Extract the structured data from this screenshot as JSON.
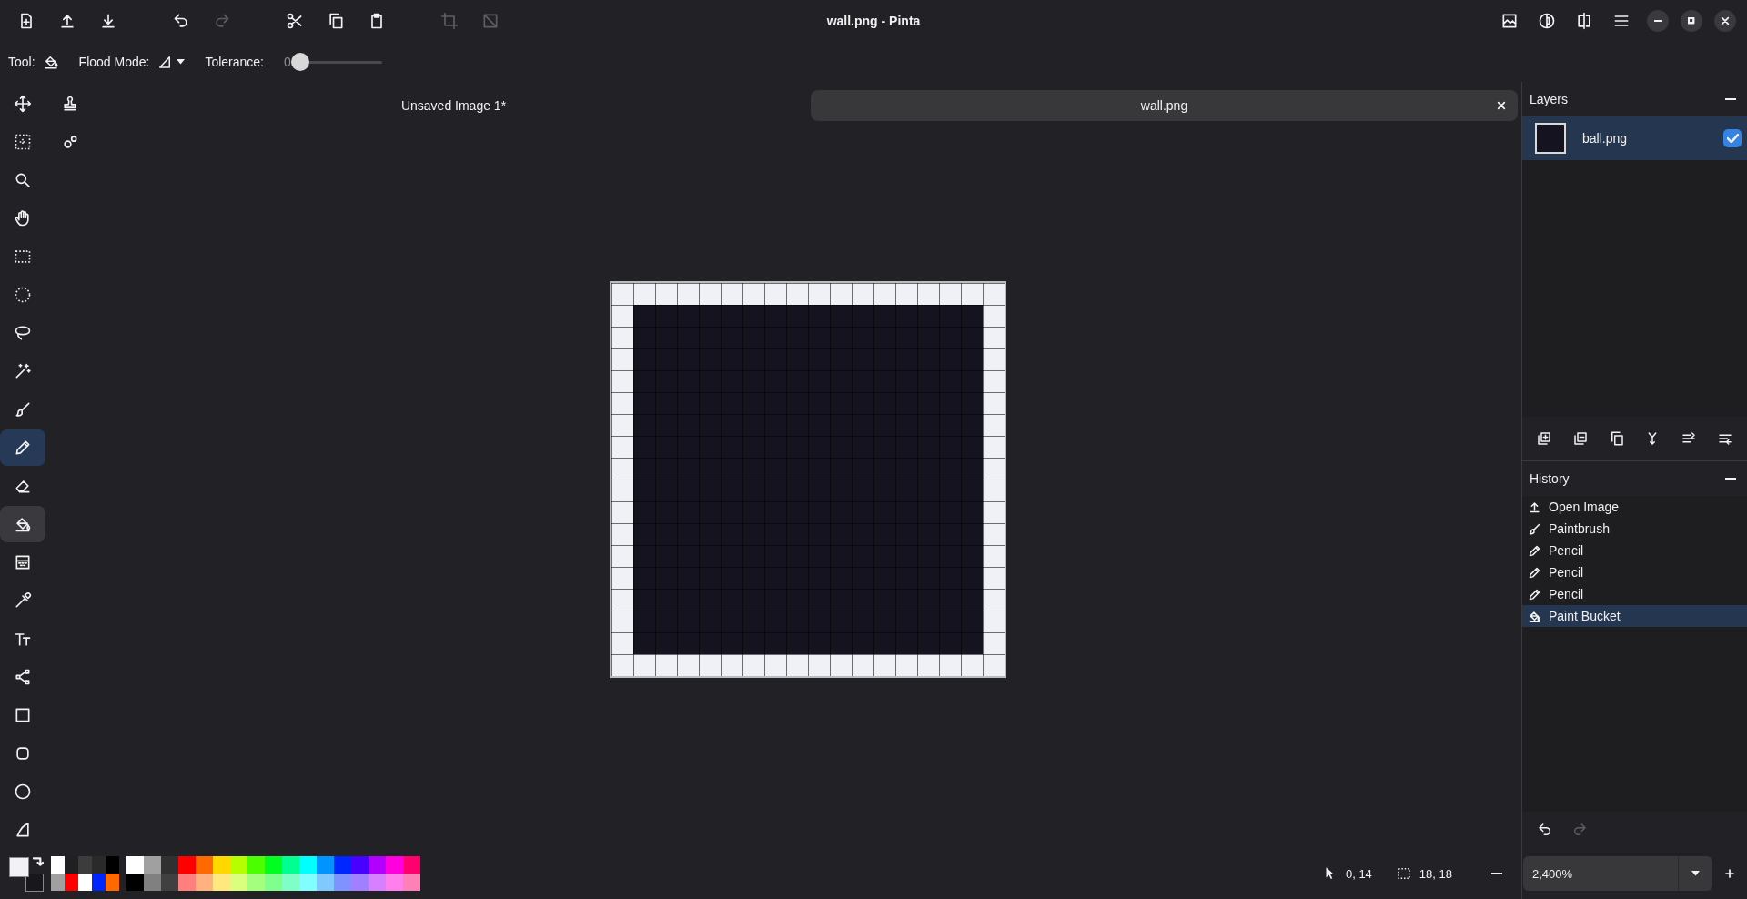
{
  "header": {
    "title": "wall.png - Pinta",
    "left_buttons": [
      {
        "kind": "new",
        "disabled": false
      },
      {
        "kind": "open",
        "disabled": false
      },
      {
        "kind": "save",
        "disabled": false
      },
      {
        "kind": "undo",
        "disabled": false
      },
      {
        "kind": "redo",
        "disabled": true
      },
      {
        "kind": "cut",
        "disabled": false
      },
      {
        "kind": "copy",
        "disabled": false
      },
      {
        "kind": "paste",
        "disabled": false
      },
      {
        "kind": "crop",
        "disabled": true
      },
      {
        "kind": "deselect",
        "disabled": true
      }
    ],
    "right_buttons": [
      {
        "kind": "image"
      },
      {
        "kind": "adjustments"
      },
      {
        "kind": "effects"
      },
      {
        "kind": "menu"
      }
    ],
    "window_controls": [
      {
        "kind": "minimize"
      },
      {
        "kind": "maximize"
      },
      {
        "kind": "close"
      }
    ]
  },
  "toolbar": {
    "tool_label": "Tool:",
    "tool": {
      "kind": "bucket"
    },
    "flood_mode_label": "Flood Mode:",
    "tolerance_label": "Tolerance:",
    "tolerance_value": "0",
    "tolerance": {
      "level": 0
    }
  },
  "tools": [
    {
      "kind": "move",
      "selected": false,
      "hovered": false
    },
    {
      "kind": "moveselection",
      "selected": false,
      "hovered": false
    },
    {
      "kind": "zoom",
      "selected": false,
      "hovered": false
    },
    {
      "kind": "pan",
      "selected": false,
      "hovered": false
    },
    {
      "kind": "rectselect",
      "selected": false,
      "hovered": false
    },
    {
      "kind": "ellipseselect",
      "selected": false,
      "hovered": false
    },
    {
      "kind": "lasso",
      "selected": false,
      "hovered": false
    },
    {
      "kind": "wand",
      "selected": false,
      "hovered": false
    },
    {
      "kind": "paintbrush",
      "selected": false,
      "hovered": false
    },
    {
      "kind": "pencil",
      "selected": false,
      "hovered": true
    },
    {
      "kind": "eraser",
      "selected": false,
      "hovered": false
    },
    {
      "kind": "bucket",
      "selected": true,
      "hovered": false
    },
    {
      "kind": "gradient",
      "selected": false,
      "hovered": false
    },
    {
      "kind": "picker",
      "selected": false,
      "hovered": false
    },
    {
      "kind": "text",
      "selected": false,
      "hovered": false
    },
    {
      "kind": "curve",
      "selected": false,
      "hovered": false
    },
    {
      "kind": "rectangle",
      "selected": false,
      "hovered": false
    },
    {
      "kind": "roundrect",
      "selected": false,
      "hovered": false
    },
    {
      "kind": "ellipse",
      "selected": false,
      "hovered": false
    },
    {
      "kind": "freeform",
      "selected": false,
      "hovered": false
    },
    {
      "kind": "stamp",
      "selected": false,
      "hovered": false
    },
    {
      "kind": "recolor",
      "selected": false,
      "hovered": false
    }
  ],
  "tabs": [
    {
      "label": "Unsaved Image 1*",
      "selected": false
    },
    {
      "label": "wall.png",
      "selected": true
    }
  ],
  "layers": {
    "title": "Layers",
    "items": [
      {
        "name": "ball.png",
        "selected": true,
        "visible": true
      }
    ],
    "buttons": [
      {
        "kind": "addlayer"
      },
      {
        "kind": "deletelayer"
      },
      {
        "kind": "duplicate"
      },
      {
        "kind": "merge"
      },
      {
        "kind": "moveup"
      },
      {
        "kind": "movedown"
      }
    ]
  },
  "history": {
    "title": "History",
    "items": [
      {
        "label": "Open Image",
        "kind": "open",
        "selected": false
      },
      {
        "label": "Paintbrush",
        "kind": "paintbrush",
        "selected": false
      },
      {
        "label": "Pencil",
        "kind": "pencil",
        "selected": false
      },
      {
        "label": "Pencil",
        "kind": "pencil",
        "selected": false
      },
      {
        "label": "Pencil",
        "kind": "pencil",
        "selected": false
      },
      {
        "label": "Paint Bucket",
        "kind": "bucket",
        "selected": true
      }
    ],
    "buttons": [
      {
        "kind": "undo",
        "disabled": false
      },
      {
        "kind": "redo",
        "disabled": true
      }
    ]
  },
  "palette": {
    "primary": {
      "color": "#f2f2f6"
    },
    "secondary": {
      "color": "#18181c"
    },
    "recent_colors": [
      {
        "color": "#ffffff"
      },
      {
        "color": "#202022"
      },
      {
        "color": "#3c3c3c"
      },
      {
        "color": "#2a2a2a"
      },
      {
        "color": "#000000"
      },
      {
        "color": "#a0a0a0"
      },
      {
        "color": "#ff0000"
      },
      {
        "color": "#ffffff"
      },
      {
        "color": "#0026ff"
      },
      {
        "color": "#ff6a00"
      }
    ],
    "colors": [
      {
        "color": "#ffffff"
      },
      {
        "color": "#a0a0a0"
      },
      {
        "color": "#303030"
      },
      {
        "color": "#ff0000"
      },
      {
        "color": "#ff6a00"
      },
      {
        "color": "#ffd800"
      },
      {
        "color": "#b6ff00"
      },
      {
        "color": "#4cff00"
      },
      {
        "color": "#00ff21"
      },
      {
        "color": "#00ff90"
      },
      {
        "color": "#00ffff"
      },
      {
        "color": "#0094ff"
      },
      {
        "color": "#0026ff"
      },
      {
        "color": "#4800ff"
      },
      {
        "color": "#b200ff"
      },
      {
        "color": "#ff00dc"
      },
      {
        "color": "#ff006e"
      },
      {
        "color": "#000000"
      },
      {
        "color": "#808080"
      },
      {
        "color": "#404040"
      },
      {
        "color": "#ff7f7f"
      },
      {
        "color": "#ffb27f"
      },
      {
        "color": "#ffe97f"
      },
      {
        "color": "#daff7f"
      },
      {
        "color": "#a5ff7f"
      },
      {
        "color": "#7fff8e"
      },
      {
        "color": "#7fffc5"
      },
      {
        "color": "#7fffff"
      },
      {
        "color": "#7fc9ff"
      },
      {
        "color": "#7f92ff"
      },
      {
        "color": "#a17fff"
      },
      {
        "color": "#d67fff"
      },
      {
        "color": "#ff7fed"
      },
      {
        "color": "#ff7fb6"
      }
    ]
  },
  "status": {
    "cursor_position": "0, 14",
    "selection_size": "18, 18",
    "zoom": "2,400%"
  }
}
